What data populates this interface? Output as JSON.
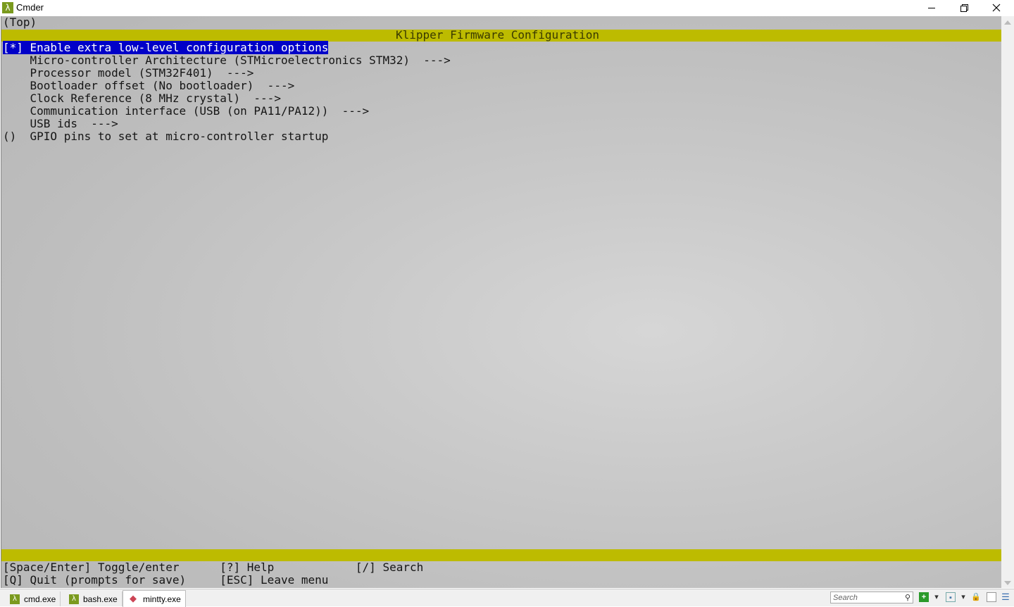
{
  "window": {
    "title": "Cmder",
    "app_icon": "λ"
  },
  "terminal": {
    "location": "(Top)",
    "config_title": "Klipper Firmware Configuration",
    "menu": [
      {
        "text": "[*] Enable extra low-level configuration options",
        "selected": true
      },
      {
        "text": "    Micro-controller Architecture (STMicroelectronics STM32)  --->"
      },
      {
        "text": "    Processor model (STM32F401)  --->"
      },
      {
        "text": "    Bootloader offset (No bootloader)  --->"
      },
      {
        "text": "    Clock Reference (8 MHz crystal)  --->"
      },
      {
        "text": "    Communication interface (USB (on PA11/PA12))  --->"
      },
      {
        "text": "    USB ids  --->"
      },
      {
        "text": "()  GPIO pins to set at micro-controller startup"
      }
    ],
    "help_line1": "[Space/Enter] Toggle/enter      [?] Help            [/] Search",
    "help_line2": "[Q] Quit (prompts for save)     [ESC] Leave menu"
  },
  "statusbar": {
    "tabs": [
      {
        "label": "cmd.exe",
        "icon": "λ"
      },
      {
        "label": "bash.exe",
        "icon": "λ"
      },
      {
        "label": "mintty.exe",
        "icon": "◆"
      }
    ],
    "search_placeholder": "Search",
    "search_icon": "⚲"
  },
  "colors": {
    "accent_band": "#bdbb00",
    "selection": "#0000c8"
  }
}
